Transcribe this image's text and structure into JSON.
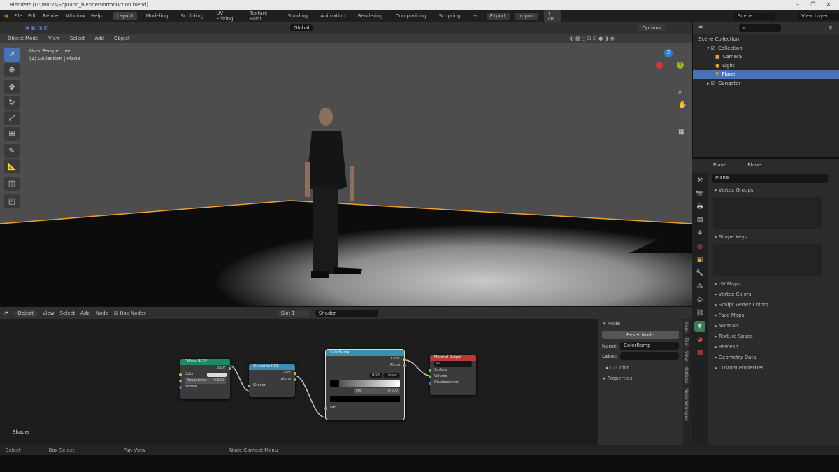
{
  "window": {
    "title": "Blender* [D:\\Works\\Soprano_blender\\Introduction.blend]",
    "minimize": "–",
    "maximize": "❐",
    "close": "✕"
  },
  "menu": [
    "File",
    "Edit",
    "Render",
    "Window",
    "Help"
  ],
  "workspaces": [
    "Layout",
    "Modeling",
    "Sculpting",
    "UV Editing",
    "Texture Paint",
    "Shading",
    "Animation",
    "Rendering",
    "Compositing",
    "Scripting",
    "+"
  ],
  "top_right": {
    "export": "Export",
    "import": "Import",
    "add": "+ ZR",
    "scene": "Scene",
    "view_layer": "View Layer"
  },
  "viewport": {
    "mode": "Object Mode",
    "menus": [
      "View",
      "Select",
      "Add",
      "Object"
    ],
    "transform": "Global",
    "options": "Options",
    "info_line1": "User Perspective",
    "info_line2": "(1) Collection | Plane",
    "gizmo": {
      "x": "X",
      "y": "Y",
      "z": "Z"
    },
    "colors": {
      "selection_outline": "#f0a030",
      "background": "#4d4d4d"
    }
  },
  "outliner": {
    "search_placeholder": "",
    "items": [
      {
        "label": "Scene Collection"
      },
      {
        "label": "Collection"
      },
      {
        "label": "Camera"
      },
      {
        "label": "Light"
      },
      {
        "label": "Plane",
        "selected": true
      },
      {
        "label": "Gangster"
      }
    ]
  },
  "properties": {
    "object": "Plane",
    "data": "Plane",
    "mesh_name": "Plane",
    "sections": [
      "Vertex Groups",
      "Shape Keys",
      "UV Maps",
      "Vertex Colors",
      "Sculpt Vertex Colors",
      "Face Maps",
      "Normals",
      "Texture Space",
      "Remesh",
      "Geometry Data",
      "Custom Properties"
    ]
  },
  "node_editor": {
    "type": "Object",
    "menus": [
      "View",
      "Select",
      "Add",
      "Node"
    ],
    "use_nodes": "Use Nodes",
    "slot": "Slot 1",
    "material": "Shader",
    "context_label": "Shader",
    "nodes": {
      "diffuse": {
        "title": "Diffuse BSDF",
        "out": "BSDF",
        "color": "Color",
        "roughness": "Roughness",
        "roughness_val": "0.000",
        "normal": "Normal",
        "header_color": "#1f8a60"
      },
      "s2rgb": {
        "title": "Shader to RGB",
        "color": "Color",
        "alpha": "Alpha",
        "shader": "Shader",
        "header_color": "#3a8fb5"
      },
      "ramp": {
        "title": "ColorRamp",
        "color": "Color",
        "alpha": "Alpha",
        "mode": "RGB",
        "interp": "Linear",
        "pos": "Pos",
        "pos_val": "0.000",
        "fac": "Fac",
        "header_color": "#3a8fb5"
      },
      "output": {
        "title": "Material Output",
        "target": "All",
        "surface": "Surface",
        "volume": "Volume",
        "displacement": "Displacement",
        "header_color": "#b53a3a"
      }
    },
    "sidebar": {
      "section": "Node",
      "reset": "Reset Node",
      "name_label": "Name:",
      "name_value": "ColorRamp",
      "label_label": "Label:",
      "label_value": "",
      "color": "Color",
      "properties": "Properties",
      "tabs": [
        "Item",
        "Tool",
        "View",
        "Options",
        "Node Wrangler"
      ]
    }
  },
  "status_bar": [
    "Select",
    "Box Select",
    "Pan View",
    "Node Context Menu"
  ]
}
